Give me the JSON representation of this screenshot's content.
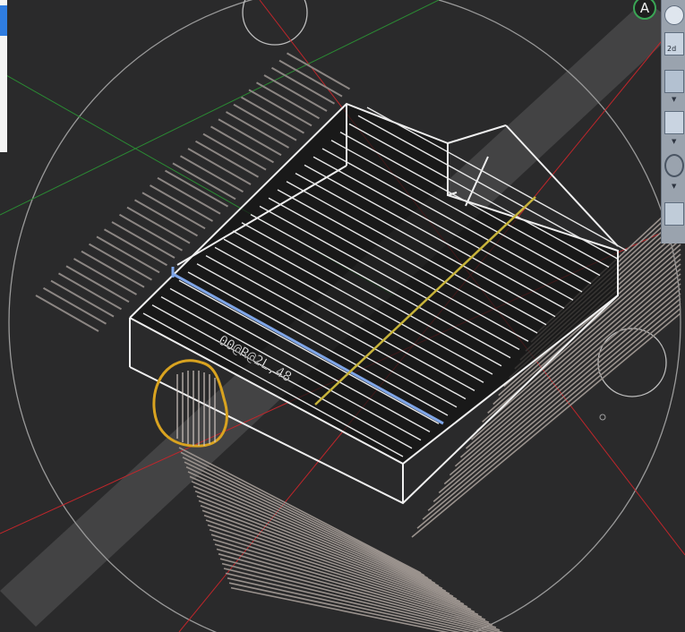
{
  "viewcube": {
    "compass_letter": "A"
  },
  "toolbar": {
    "buttons": [
      {
        "icon": "orbit-sphere-icon"
      },
      {
        "icon": "2d-view-icon",
        "label": "2d"
      },
      {
        "icon": "box-view-icon"
      },
      {
        "icon": "cube-view-icon"
      },
      {
        "icon": "circle-view-icon"
      },
      {
        "icon": "grid-view-icon"
      }
    ]
  },
  "model": {
    "annotation_text": "00@R@2L,48"
  },
  "colors": {
    "background": "#2a2a2b",
    "wireframe": "#f0f0f0",
    "ghost": "#8a8582",
    "axis_red": "#c0262b",
    "axis_green": "#2a8a33",
    "highlight_blue": "#7fa6e8",
    "highlight_yellow": "#c8b43a",
    "markup_circle": "#d9a320"
  }
}
